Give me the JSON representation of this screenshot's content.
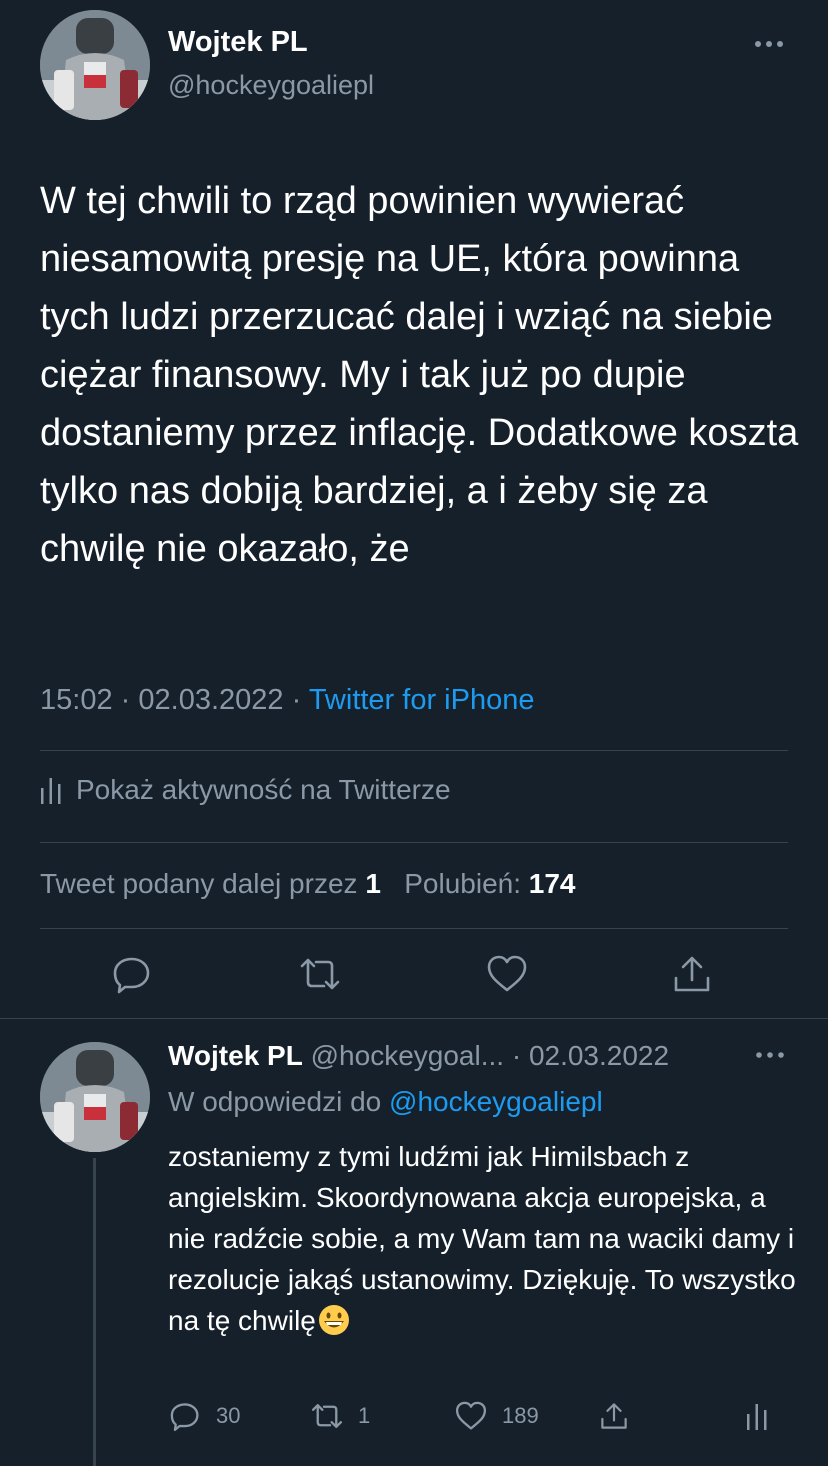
{
  "main_tweet": {
    "author_name": "Wojtek PL",
    "author_handle": "@hockeygoaliepl",
    "text": "W tej chwili to rząd powinien wywierać niesamowitą presję na UE, która powinna tych ludzi przerzucać dalej i wziąć na siebie ciężar finansowy. My i tak już po dupie dostaniemy przez inflację. Dodatkowe koszta tylko nas dobiją bardziej, a i żeby się za chwilę nie okazało, że",
    "time": "15:02",
    "date": "02.03.2022",
    "dot": "·",
    "source": "Twitter for iPhone",
    "activity_label": "Pokaż aktywność na Twitterze",
    "retweets_label": "Tweet podany dalej przez",
    "retweets_count": "1",
    "likes_label": "Polubień:",
    "likes_count": "174"
  },
  "reply_tweet": {
    "author_name": "Wojtek PL",
    "author_handle_truncated": "@hockeygoal...",
    "dot": "·",
    "date": "02.03.2022",
    "replying_label": "W odpowiedzi do",
    "replying_to": "@hockeygoaliepl",
    "text": "zostaniemy z tymi ludźmi jak Himilsbach z angielskim. Skoordynowana akcja europejska, a nie radźcie sobie, a my Wam tam na waciki damy i rezolucje jakąś ustanowimy. Dziękuję. To wszystko na tę chwilę",
    "replies_count": "30",
    "retweets_count": "1",
    "likes_count": "189"
  },
  "icons": {
    "more": "more-horizontal-icon",
    "activity": "bar-chart-icon",
    "reply": "reply-icon",
    "retweet": "retweet-icon",
    "like": "heart-icon",
    "share": "share-icon",
    "emoji": "grinning-face-emoji"
  },
  "colors": {
    "background": "#15202b",
    "text": "#ffffff",
    "muted": "#8b98a5",
    "link": "#1d9bf0",
    "divider": "#38444d"
  }
}
